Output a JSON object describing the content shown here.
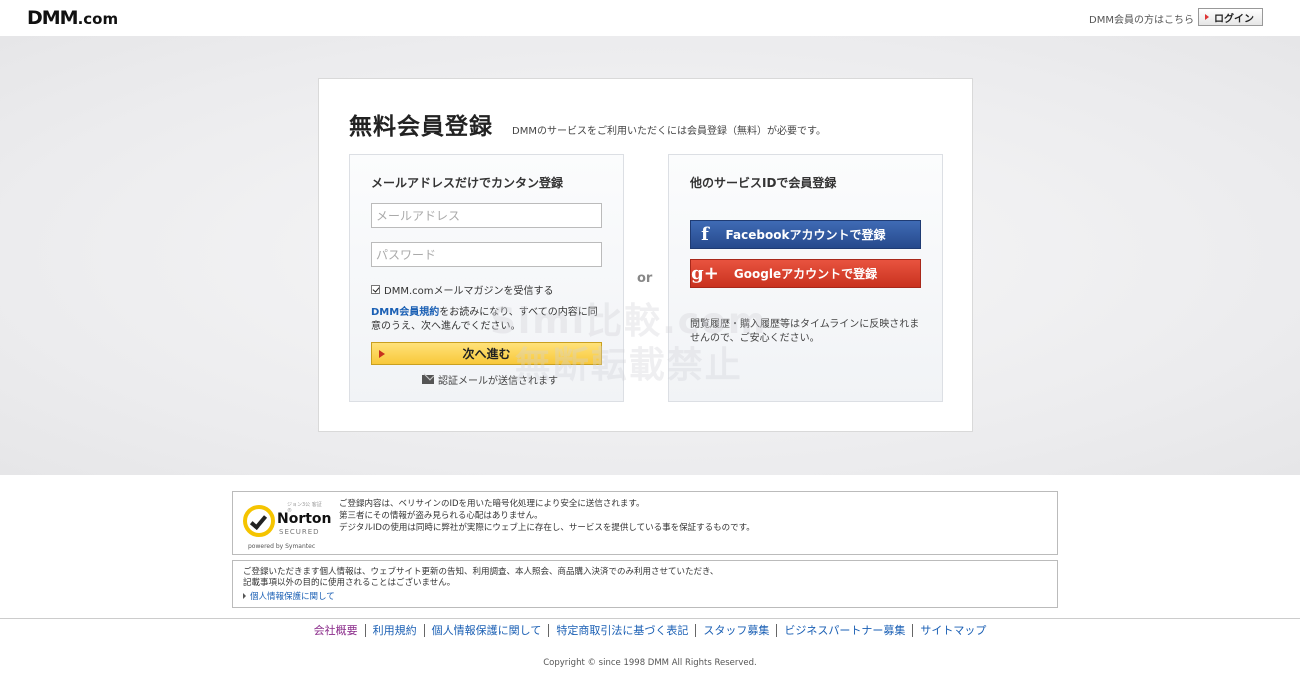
{
  "header": {
    "logo": "DMM",
    "logo_suffix": ".com",
    "member_text": "DMM会員の方はこちら",
    "login_label": "ログイン"
  },
  "card": {
    "title": "無料会員登録",
    "subtitle": "DMMのサービスをご利用いただくには会員登録（無料）が必要です。"
  },
  "email_panel": {
    "heading": "メールアドレスだけでカンタン登録",
    "email_placeholder": "メールアドレス",
    "password_placeholder": "パスワード",
    "newsletter_label": "DMM.comメールマガジンを受信する",
    "terms_link": "DMM会員規約",
    "terms_text": "をお読みになり、すべての内容に同意のうえ、次へ進んでください。",
    "next_label": "次へ進む",
    "mail_note": "認証メールが送信されます"
  },
  "or_label": "or",
  "sns_panel": {
    "heading": "他のサービスIDで会員登録",
    "facebook_icon": "f",
    "facebook_label": "Facebookアカウントで登録",
    "google_icon": "g+",
    "google_label": "Googleアカウントで登録",
    "history_note": "閲覧履歴・購入履歴等はタイムラインに反映されませんので、ご安心ください。"
  },
  "watermark": {
    "line1": "Simi比較.com",
    "line2": "無断転載禁止"
  },
  "security": {
    "badge_top": "ジョン3公 客証 ®",
    "badge_name": "Norton",
    "badge_secured": "SECURED",
    "badge_powered": "powered by Symantec",
    "line1": "ご登録内容は、ベリサインのIDを用いた暗号化処理により安全に送信されます。",
    "line2": "第三者にその情報が盗み見られる心配はありません。",
    "line3": "デジタルIDの使用は同時に弊社が実際にウェブ上に存在し、サービスを提供している事を保証するものです。"
  },
  "privacy": {
    "line1": "ご登録いただきます個人情報は、ウェブサイト更新の告知、利用調査、本人照会、商品購入決済でのみ利用させていただき、",
    "line2": "記載事項以外の目的に使用されることはございません。",
    "link": "個人情報保護に関して"
  },
  "footer": {
    "links": [
      "会社概要",
      "利用規約",
      "個人情報保護に関して",
      "特定商取引法に基づく表記",
      "スタッフ募集",
      "ビジネスパートナー募集",
      "サイトマップ"
    ],
    "copyright": "Copyright © since 1998 DMM All Rights Reserved."
  }
}
